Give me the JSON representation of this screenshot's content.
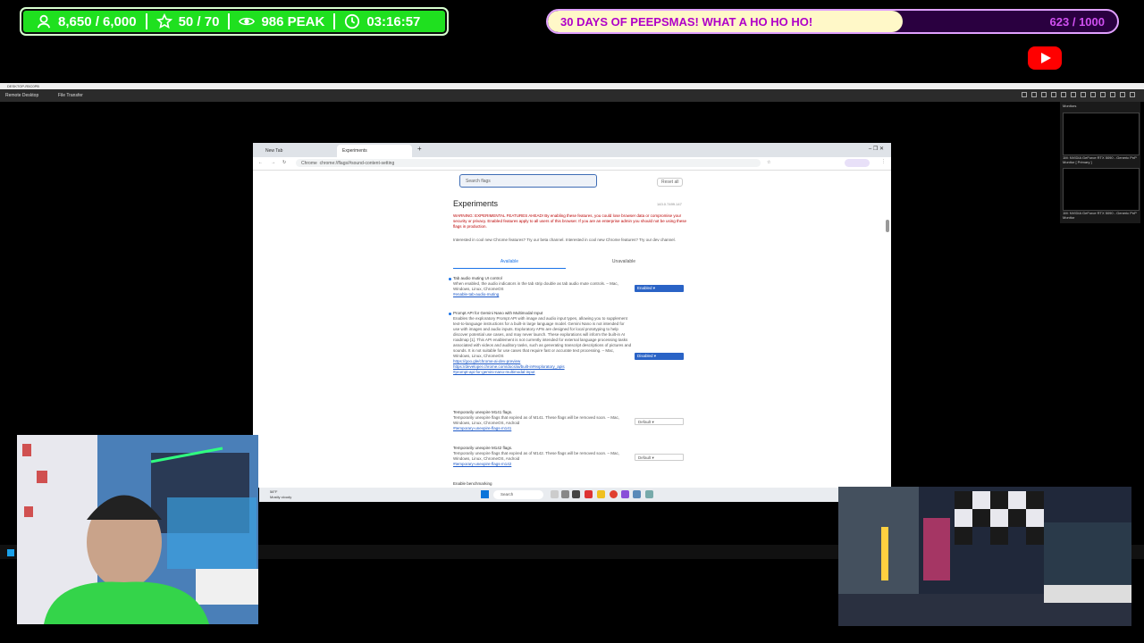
{
  "stats": {
    "followers": "8,650 / 6,000",
    "subs": "50 / 70",
    "peak": "986 PEAK",
    "uptime": "03:16:57"
  },
  "goal": {
    "title": "30 DAYS OF PEEPSMAS! WHAT A HO HO HO!",
    "count": "623 / 1000",
    "progress": 0.623,
    "fill_color": "#fff8c8",
    "accent": "#b000c8"
  },
  "remote_desktop": {
    "title": "DESKTOP-R5C0PB",
    "menu": [
      "Remote Desktop",
      "File Transfer"
    ],
    "monitors_label": "Monitors",
    "monitor1": "1M: NVIDIA GeForce RTX 5090 - Generic PnP Monitor [ Primary ]",
    "monitor2": "1M: NVIDIA GeForce RTX 5090 - Generic PnP Monitor"
  },
  "browser": {
    "tabs": [
      "New Tab",
      "Experiments"
    ],
    "address": "chrome://flags/#sound-content-setting",
    "address_prefix": "Chrome",
    "search_placeholder": "Search flags",
    "reset_label": "Reset all",
    "version": "143.0.7499.147",
    "heading": "Experiments",
    "warning": "WARNING: EXPERIMENTAL FEATURES AHEAD! By enabling these features, you could lose browser data or compromise your security or privacy. Enabled features apply to all users of this browser. If you are an enterprise admin you should not be using these flags in production.",
    "info": "Interested in cool new Chrome features? Try our beta channel. Interested in cool new Chrome features? Try our dev channel.",
    "tab_available": "Available",
    "tab_unavailable": "Unavailable",
    "flags": [
      {
        "title": "Tab audio muting UI control",
        "desc": "When enabled, the audio indicators in the tab strip double as tab audio mute controls. – Mac, Windows, Linux, ChromeOS",
        "link": "#enable-tab-audio-muting",
        "value": "Enabled"
      },
      {
        "title": "Prompt API for Gemini Nano with Multimodal Input",
        "desc": "Enables the exploratory Prompt API with image and audio input types, allowing you to supplement text-to-language instructions for a built-in large language model. Gemini Nano is not intended for use with images and audio inputs. Exploratory APIs are designed for local prototyping to help discover potential use cases, and may never launch. These explorations will inform the built-in AI roadmap [1]. This API enablement is not currently intended for external language processing tasks associated with videos and auditory tasks, such as generating transcript descriptions of pictures and sounds. It is not suitable for use cases that require fast or accurate text processing. – Mac, Windows, Linux, ChromeOS",
        "links": [
          "https://goo.gle/chrome-ai-dev-preview",
          "https://developer.chrome.com/docs/ai/built-in#exploratory_apis"
        ],
        "link": "#prompt-api-for-gemini-nano-multimodal-input",
        "value": "Disabled"
      },
      {
        "title": "Temporarily unexpire M141 flags.",
        "desc": "Temporarily unexpire flags that expired as of M141. These flags will be removed soon. – Mac, Windows, Linux, ChromeOS, Android",
        "link": "#temporary-unexpire-flags-m141",
        "value": "Default"
      },
      {
        "title": "Temporarily unexpire M142 flags.",
        "desc": "Temporarily unexpire flags that expired as of M142. These flags will be removed soon. – Mac, Windows, Linux, ChromeOS, Android",
        "link": "#temporary-unexpire-flags-m142",
        "value": "Default"
      },
      {
        "title": "Enable benchmarking",
        "desc": "",
        "link": "",
        "value": ""
      }
    ]
  },
  "taskbar": {
    "weather": "58°F",
    "weather_desc": "Mostly cloudy",
    "search_label": "Search"
  }
}
